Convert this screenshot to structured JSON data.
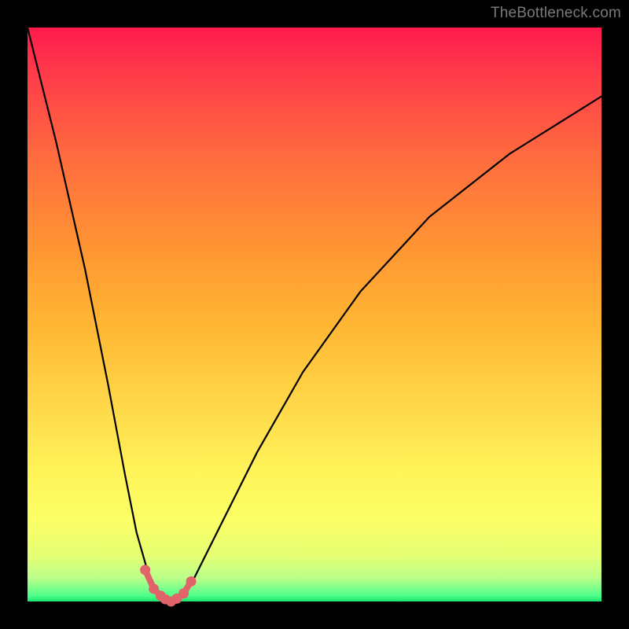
{
  "watermark": "TheBottleneck.com",
  "chart_data": {
    "type": "line",
    "title": "",
    "xlabel": "",
    "ylabel": "",
    "xlim": [
      0,
      100
    ],
    "ylim": [
      0,
      100
    ],
    "note": "Bottleneck curve: y = percentage bottleneck, x = relative component performance. Minimum near x≈25 indicates balanced pairing; colored background encodes severity (red=high bottleneck, green=none).",
    "series": [
      {
        "name": "bottleneck-percentage",
        "x": [
          0,
          5,
          10,
          14,
          17,
          19,
          21,
          22,
          23,
          24,
          25,
          26,
          27,
          28,
          30,
          34,
          40,
          48,
          58,
          70,
          84,
          100
        ],
        "y": [
          100,
          80,
          58,
          38,
          22,
          12,
          5,
          2,
          0.7,
          0.2,
          0,
          0.2,
          0.8,
          2,
          6,
          14,
          26,
          40,
          54,
          67,
          78,
          88
        ]
      }
    ],
    "gradient_scale": {
      "0": "#18e46a",
      "8": "#baff8a",
      "20": "#fbff66",
      "40": "#ffd84a",
      "60": "#ff9433",
      "80": "#ff3b4a",
      "100": "#ff1a4d"
    },
    "colors": {
      "curve": "#000000",
      "markers": "#e06469",
      "frame": "#000000"
    },
    "markers": {
      "name": "highlighted-near-minimum",
      "x": [
        20.5,
        22,
        23.2,
        24,
        25,
        26,
        27.2,
        28.5
      ],
      "y": [
        5.5,
        2.2,
        1,
        0.4,
        0,
        0.5,
        1.4,
        3.5
      ]
    }
  }
}
